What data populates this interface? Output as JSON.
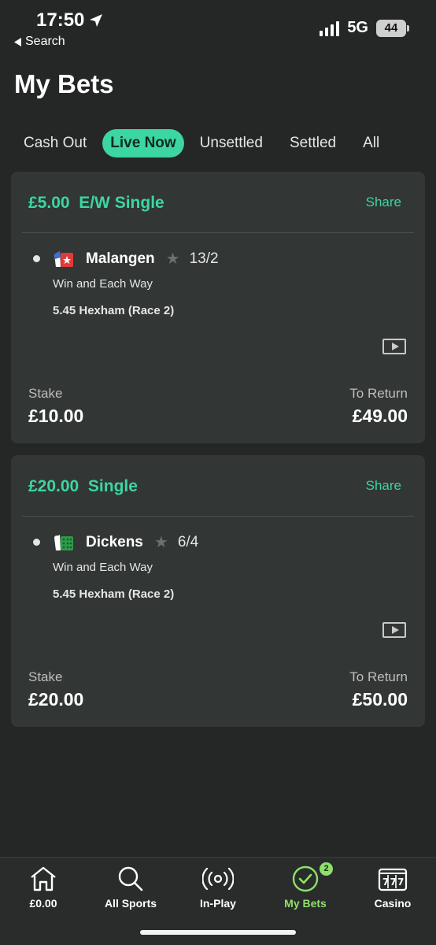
{
  "status_bar": {
    "time": "17:50",
    "back_label": "Search",
    "network": "5G",
    "battery": "44"
  },
  "page_title": "My Bets",
  "tabs": [
    {
      "label": "Cash Out",
      "active": false
    },
    {
      "label": "Live Now",
      "active": true
    },
    {
      "label": "Unsettled",
      "active": false
    },
    {
      "label": "Settled",
      "active": false
    },
    {
      "label": "All",
      "active": false
    }
  ],
  "bets": [
    {
      "header": "£5.00  E/W Single",
      "share_label": "Share",
      "horse": "Malangen",
      "odds": "13/2",
      "market": "Win and Each Way",
      "race": "5.45 Hexham (Race 2)",
      "stake_label": "Stake",
      "stake": "£10.00",
      "return_label": "To Return",
      "return": "£49.00"
    },
    {
      "header": "£20.00  Single",
      "share_label": "Share",
      "horse": "Dickens",
      "odds": "6/4",
      "market": "Win and Each Way",
      "race": "5.45 Hexham (Race 2)",
      "stake_label": "Stake",
      "stake": "£20.00",
      "return_label": "To Return",
      "return": "£50.00"
    }
  ],
  "bottom_nav": [
    {
      "label": "£0.00",
      "icon": "home-icon"
    },
    {
      "label": "All Sports",
      "icon": "search-icon"
    },
    {
      "label": "In-Play",
      "icon": "broadcast-icon"
    },
    {
      "label": "My Bets",
      "icon": "check-circle-icon",
      "badge": "2",
      "active": true
    },
    {
      "label": "Casino",
      "icon": "slot-machine-icon"
    }
  ],
  "colors": {
    "accent": "#3bd6a2",
    "nav_active": "#8fe06a",
    "background": "#252726",
    "card": "#323634"
  }
}
